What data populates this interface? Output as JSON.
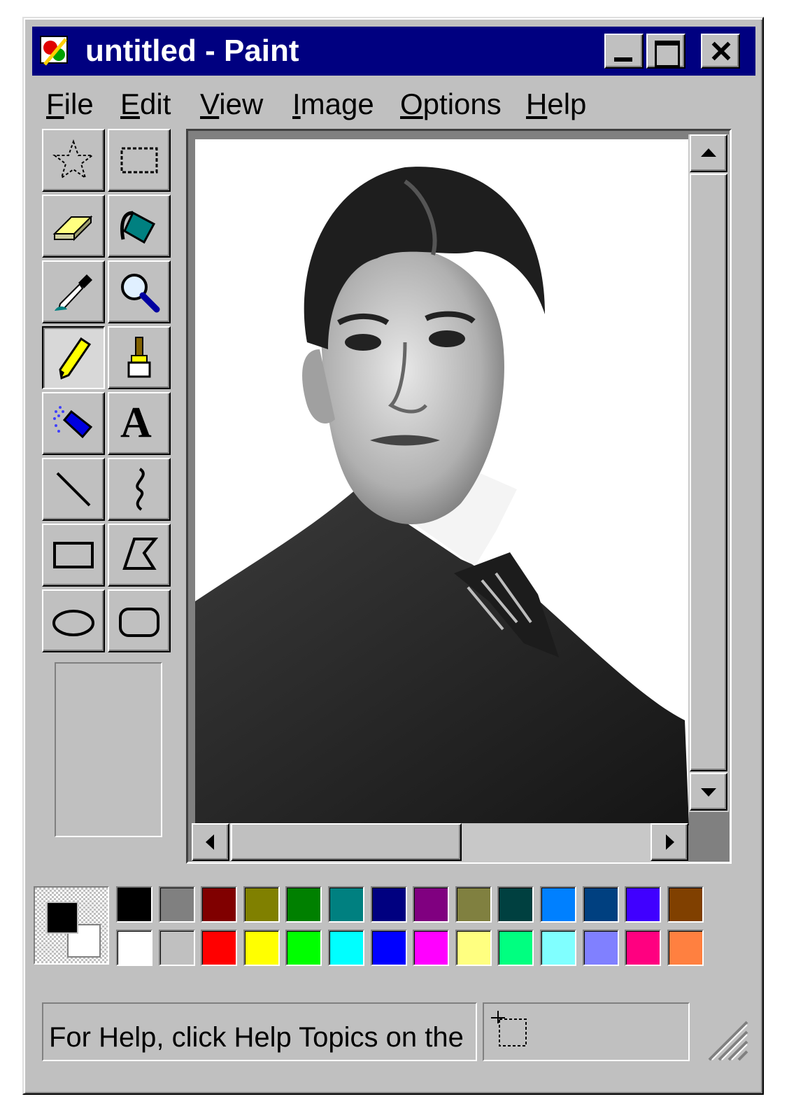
{
  "window": {
    "title": "untitled - Paint",
    "controls": [
      "minimize",
      "maximize",
      "close"
    ]
  },
  "menu": {
    "items": [
      {
        "label": "File",
        "accel": "F",
        "rest": "ile"
      },
      {
        "label": "Edit",
        "accel": "E",
        "rest": "dit"
      },
      {
        "label": "View",
        "accel": "V",
        "rest": "iew"
      },
      {
        "label": "Image",
        "accel": "I",
        "rest": "mage"
      },
      {
        "label": "Options",
        "accel": "O",
        "rest": "ptions"
      },
      {
        "label": "Help",
        "accel": "H",
        "rest": "elp"
      }
    ]
  },
  "tools": [
    {
      "name": "free-form-select",
      "icon": "star-select-icon"
    },
    {
      "name": "rectangle-select",
      "icon": "rect-select-icon"
    },
    {
      "name": "eraser",
      "icon": "eraser-icon"
    },
    {
      "name": "fill-with-color",
      "icon": "paint-bucket-icon"
    },
    {
      "name": "pick-color",
      "icon": "eyedropper-icon"
    },
    {
      "name": "magnifier",
      "icon": "magnifier-icon"
    },
    {
      "name": "pencil",
      "icon": "pencil-icon",
      "selected": true
    },
    {
      "name": "brush",
      "icon": "brush-icon"
    },
    {
      "name": "airbrush",
      "icon": "airbrush-icon"
    },
    {
      "name": "text",
      "icon": "text-icon",
      "glyph": "A"
    },
    {
      "name": "line",
      "icon": "line-icon"
    },
    {
      "name": "curve",
      "icon": "curve-icon"
    },
    {
      "name": "rectangle",
      "icon": "rectangle-icon"
    },
    {
      "name": "polygon",
      "icon": "polygon-icon"
    },
    {
      "name": "ellipse",
      "icon": "ellipse-icon"
    },
    {
      "name": "rounded-rectangle",
      "icon": "rounded-rectangle-icon"
    }
  ],
  "canvas": {
    "image": "black-and-white-portrait-photo"
  },
  "colors": {
    "foreground": "#000000",
    "background": "#ffffff",
    "palette_top": [
      "#000000",
      "#808080",
      "#800000",
      "#808000",
      "#008000",
      "#008080",
      "#000080",
      "#800080",
      "#808040",
      "#004040",
      "#0080ff",
      "#004080",
      "#4000ff",
      "#804000"
    ],
    "palette_bottom": [
      "#ffffff",
      "#c0c0c0",
      "#ff0000",
      "#ffff00",
      "#00ff00",
      "#00ffff",
      "#0000ff",
      "#ff00ff",
      "#ffff80",
      "#00ff80",
      "#80ffff",
      "#8080ff",
      "#ff0080",
      "#ff8040"
    ]
  },
  "status": {
    "help_text": "For Help, click Help Topics on the",
    "position_icon": "coordinates-icon"
  }
}
